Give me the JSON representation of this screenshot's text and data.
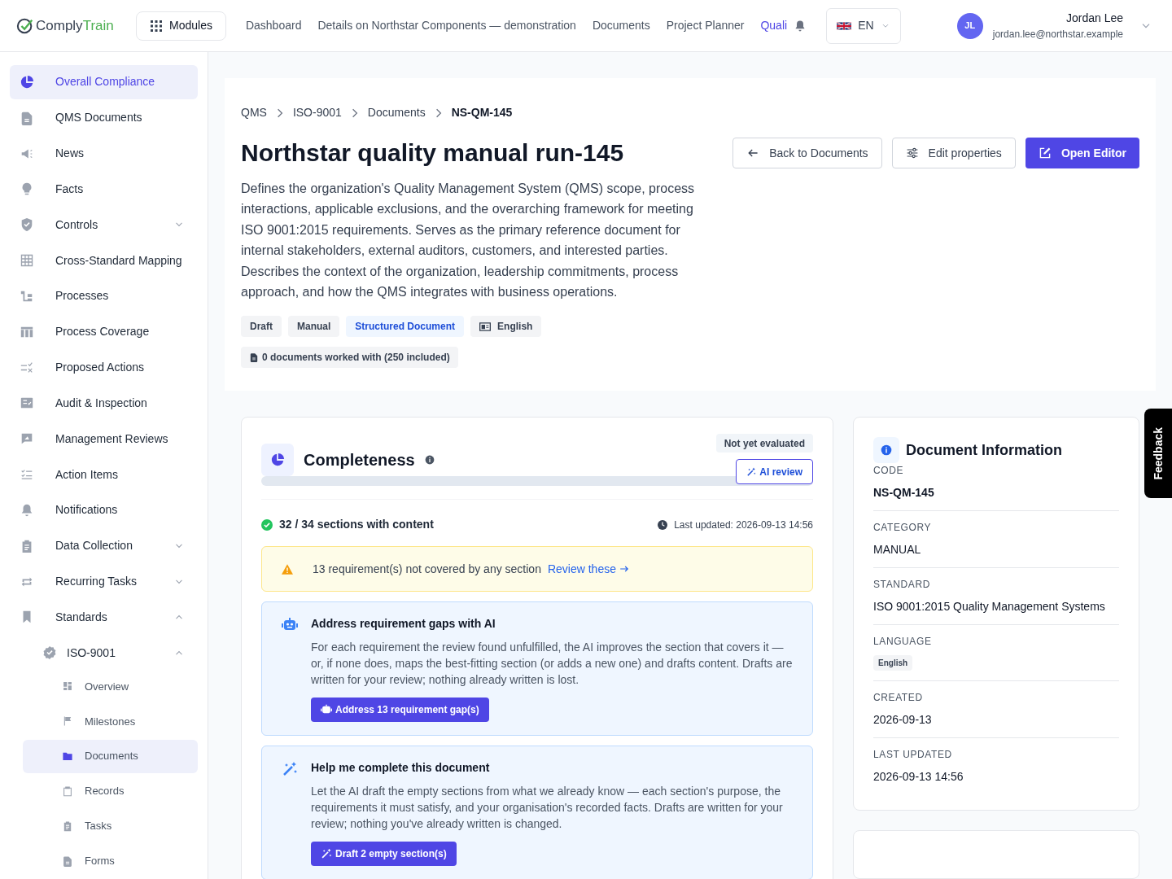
{
  "header": {
    "logo_a": "Comply",
    "logo_b": "Train",
    "modules": "Modules",
    "nav": [
      {
        "label": "Dashboard",
        "selected": false
      },
      {
        "label": "Details on Northstar Components — demonstration",
        "selected": false
      },
      {
        "label": "Documents",
        "selected": false
      },
      {
        "label": "Project Planner",
        "selected": false
      },
      {
        "label": "Quali",
        "selected": true
      }
    ],
    "language": "EN",
    "user": {
      "initials": "JL",
      "name": "Jordan Lee",
      "email": "jordan.lee@northstar.example"
    }
  },
  "sidebar": {
    "items": [
      {
        "label": "Overall Compliance",
        "selected": true
      },
      {
        "label": "QMS Documents",
        "selected": false
      },
      {
        "label": "News",
        "selected": false
      },
      {
        "label": "Facts",
        "selected": false
      },
      {
        "label": "Controls",
        "selected": false,
        "expanded": false
      },
      {
        "label": "Cross-Standard Mapping",
        "selected": false
      },
      {
        "label": "Processes",
        "selected": false
      },
      {
        "label": "Process Coverage",
        "selected": false
      },
      {
        "label": "Proposed Actions",
        "selected": false
      },
      {
        "label": "Audit & Inspection",
        "selected": false
      },
      {
        "label": "Management Reviews",
        "selected": false
      },
      {
        "label": "Action Items",
        "selected": false
      },
      {
        "label": "Notifications",
        "selected": false
      },
      {
        "label": "Data Collection",
        "selected": false,
        "expanded": false
      },
      {
        "label": "Recurring Tasks",
        "selected": false,
        "expanded": false
      },
      {
        "label": "Standards",
        "selected": false,
        "expanded": true,
        "children": [
          {
            "label": "ISO-9001",
            "selected": false,
            "expanded": true,
            "children": [
              {
                "label": "Overview",
                "selected": false
              },
              {
                "label": "Milestones",
                "selected": false
              },
              {
                "label": "Documents",
                "selected": true
              },
              {
                "label": "Records",
                "selected": false
              },
              {
                "label": "Tasks",
                "selected": false
              },
              {
                "label": "Forms",
                "selected": false
              }
            ]
          }
        ]
      }
    ]
  },
  "breadcrumb": [
    "QMS",
    "ISO-9001",
    "Documents",
    "NS-QM-145"
  ],
  "document": {
    "title": "Northstar quality manual run-145",
    "description": "Defines the organization's Quality Management System (QMS) scope, process interactions, applicable exclusions, and the overarching framework for meeting ISO 9001:2015 requirements. Serves as the primary reference document for internal stakeholders, external auditors, customers, and interested parties. Describes the context of the organization, leadership commitments, process approach, and how the QMS integrates with business operations.",
    "actions": [
      {
        "label": "Back to Documents",
        "kind": "back"
      },
      {
        "label": "Edit properties",
        "kind": "edit"
      },
      {
        "label": "Open Editor",
        "kind": "primary"
      }
    ],
    "tags": [
      {
        "label": "Draft",
        "kind": "plain"
      },
      {
        "label": "Manual",
        "kind": "plain"
      },
      {
        "label": "Structured Document",
        "kind": "accent"
      },
      {
        "label": "English",
        "kind": "language"
      }
    ],
    "usage": "0 documents worked with (250 included)"
  },
  "completeness": {
    "title": "Completeness",
    "status": "Not yet evaluated",
    "ai_review": "AI review",
    "sections": "32 / 34 sections with content",
    "last_updated": "Last updated: 2026-09-13 14:56",
    "warning": {
      "text": "13 requirement(s) not covered by any section",
      "link": "Review these"
    },
    "panels": [
      {
        "kind": "robot",
        "title": "Address requirement gaps with AI",
        "text": "For each requirement the review found unfulfilled, the AI improves the section that covers it — or, if none does, maps the best-fitting section (or adds a new one) and drafts content. Drafts are written for your review; nothing already written is lost.",
        "button": "Address 13 requirement gap(s)"
      },
      {
        "kind": "wand",
        "title": "Help me complete this document",
        "text": "Let the AI draft the empty sections from what we already know — each section's purpose, the requirements it must satisfy, and your organisation's recorded facts. Drafts are written for your review; nothing you've already written is changed.",
        "button": "Draft 2 empty section(s)"
      }
    ]
  },
  "info": {
    "title": "Document Information",
    "fields": [
      {
        "label": "CODE",
        "value": "NS-QM-145",
        "kind": "bold"
      },
      {
        "label": "CATEGORY",
        "value": "MANUAL",
        "kind": "text"
      },
      {
        "label": "STANDARD",
        "value": "ISO 9001:2015 Quality Management Systems",
        "kind": "text"
      },
      {
        "label": "LANGUAGE",
        "value": "English",
        "kind": "badge"
      },
      {
        "label": "CREATED",
        "value": "2026-09-13",
        "kind": "text"
      },
      {
        "label": "LAST UPDATED",
        "value": "2026-09-13 14:56",
        "kind": "text"
      }
    ]
  },
  "feedback": "Feedback"
}
